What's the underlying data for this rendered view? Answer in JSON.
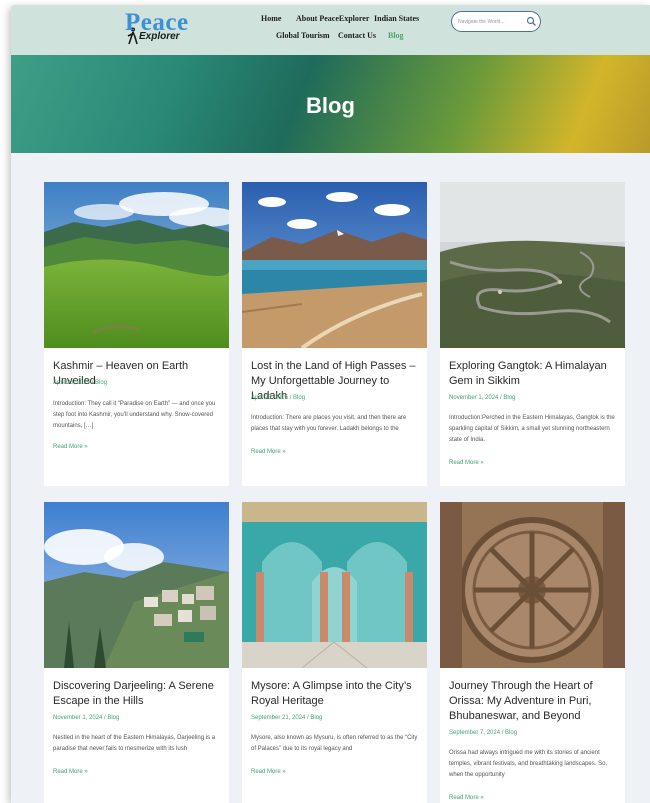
{
  "logo": {
    "main": "Peace",
    "sub": "Explorer"
  },
  "nav": {
    "items": [
      {
        "label": "Home"
      },
      {
        "label": "About PeaceExplorer"
      },
      {
        "label": "Indian States"
      },
      {
        "label": "Global Tourism"
      },
      {
        "label": "Contact Us"
      },
      {
        "label": "Blog"
      }
    ],
    "active": "Blog"
  },
  "search": {
    "placeholder": "Navigate the World..."
  },
  "hero": {
    "title": "Blog"
  },
  "colors": {
    "accent": "#3fa570",
    "header_bg": "#cfe3dc",
    "page_bg": "#eef1f6"
  },
  "posts": [
    {
      "title": "Kashmir – Heaven on Earth Unveiled",
      "meta": "April 23, 2025 / Blog",
      "excerpt": "Introduction: They call it “Paradise on Earth” — and once you step foot into Kashmir, you’ll understand why. Snow-covered mountains, […]",
      "link": "Read More »",
      "image": "green-valley-mountains"
    },
    {
      "title": "Lost in the Land of High Passes – My Unforgettable Journey to Ladakh",
      "meta": "April 23, 2025 / Blog",
      "excerpt": "Introduction: There are places you visit, and then there are places that stay with you forever. Ladakh belongs to the",
      "link": "Read More »",
      "image": "mountain-lake-road"
    },
    {
      "title": "Exploring Gangtok: A Himalayan Gem in Sikkim",
      "meta": "November 1, 2024 / Blog",
      "excerpt": "Introduction:Perched in the Eastern Himalayas, Gangtok is the sparkling capital of Sikkim, a small yet stunning northeastern state of India.",
      "link": "Read More »",
      "image": "winding-mountain-road"
    },
    {
      "title": "Discovering Darjeeling: A Serene Escape in the Hills",
      "meta": "November 1, 2024 / Blog",
      "excerpt": "Nestled in the heart of the Eastern Himalayas, Darjeeling is a paradise that never fails to mesmerize with its lush",
      "link": "Read More »",
      "image": "hill-town"
    },
    {
      "title": "Mysore: A Glimpse into the City’s Royal Heritage",
      "meta": "September 21, 2024 / Blog",
      "excerpt": "Mysore, also known as Mysuru, is often referred to as the “City of Palaces” due to its royal legacy and",
      "link": "Read More »",
      "image": "palace-hall-arches"
    },
    {
      "title": "Journey Through the Heart of Orissa: My Adventure in Puri, Bhubaneswar, and Beyond",
      "meta": "September 7, 2024 / Blog",
      "excerpt": "Orissa had always intrigued me with its stories of ancient temples, vibrant festivals, and breathtaking landscapes. So, when the opportunity",
      "link": "Read More »",
      "image": "stone-chariot-wheel"
    }
  ]
}
